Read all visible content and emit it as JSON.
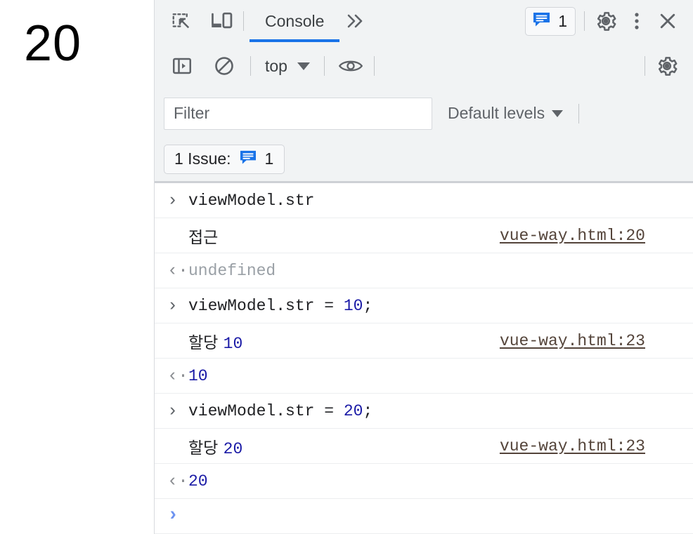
{
  "viewport": {
    "content": "20"
  },
  "devtools": {
    "tabbar": {
      "inspect_icon": "inspect-element-icon",
      "device_icon": "device-toolbar-icon",
      "tabs": [
        {
          "label": "Console",
          "active": true
        }
      ],
      "more_tabs_label": "»",
      "issues_count": "1",
      "issues_icon": "issue-message-icon",
      "settings_icon": "gear-icon",
      "more_options_icon": "kebab-menu-icon",
      "close_icon": "close-icon"
    },
    "console_toolbar": {
      "sidebar_icon": "console-sidebar-icon",
      "clear_icon": "clear-console-icon",
      "context": "top",
      "eye_icon": "live-expression-eye-icon",
      "settings_icon": "gear-icon"
    },
    "filterbar": {
      "filter_placeholder": "Filter",
      "filter_value": "",
      "levels_label": "Default levels"
    },
    "issuebar": {
      "label": "1 Issue:",
      "count": "1",
      "icon": "issue-message-icon"
    },
    "log": {
      "rows": [
        {
          "kind": "input",
          "marker": "›",
          "segments": [
            {
              "text": "viewModel.str",
              "style": "plain"
            }
          ],
          "source": ""
        },
        {
          "kind": "message",
          "marker": "",
          "segments": [
            {
              "text": "접근",
              "style": "korean"
            }
          ],
          "source": "vue-way.html:20"
        },
        {
          "kind": "output",
          "marker": "‹·",
          "segments": [
            {
              "text": "undefined",
              "style": "dim"
            }
          ],
          "source": ""
        },
        {
          "kind": "input",
          "marker": "›",
          "segments": [
            {
              "text": "viewModel.str = ",
              "style": "plain"
            },
            {
              "text": "10",
              "style": "num"
            },
            {
              "text": ";",
              "style": "plain"
            }
          ],
          "source": ""
        },
        {
          "kind": "message",
          "marker": "",
          "segments": [
            {
              "text": "할당 ",
              "style": "korean"
            },
            {
              "text": "10",
              "style": "num"
            }
          ],
          "source": "vue-way.html:23"
        },
        {
          "kind": "output",
          "marker": "‹·",
          "segments": [
            {
              "text": "10",
              "style": "num"
            }
          ],
          "source": ""
        },
        {
          "kind": "input",
          "marker": "›",
          "segments": [
            {
              "text": "viewModel.str = ",
              "style": "plain"
            },
            {
              "text": "20",
              "style": "num"
            },
            {
              "text": ";",
              "style": "plain"
            }
          ],
          "source": ""
        },
        {
          "kind": "message",
          "marker": "",
          "segments": [
            {
              "text": "할당 ",
              "style": "korean"
            },
            {
              "text": "20",
              "style": "num"
            }
          ],
          "source": "vue-way.html:23"
        },
        {
          "kind": "output",
          "marker": "‹·",
          "segments": [
            {
              "text": "20",
              "style": "num"
            }
          ],
          "source": ""
        },
        {
          "kind": "prompt",
          "marker": "›",
          "segments": [],
          "source": ""
        }
      ]
    }
  },
  "colors": {
    "accent": "#1a73e8",
    "number": "#1a1aa6",
    "prompt": "#6d93f0",
    "panel_bg": "#f1f3f4",
    "link": "#54443a",
    "dim_text": "#9aa0a6"
  }
}
